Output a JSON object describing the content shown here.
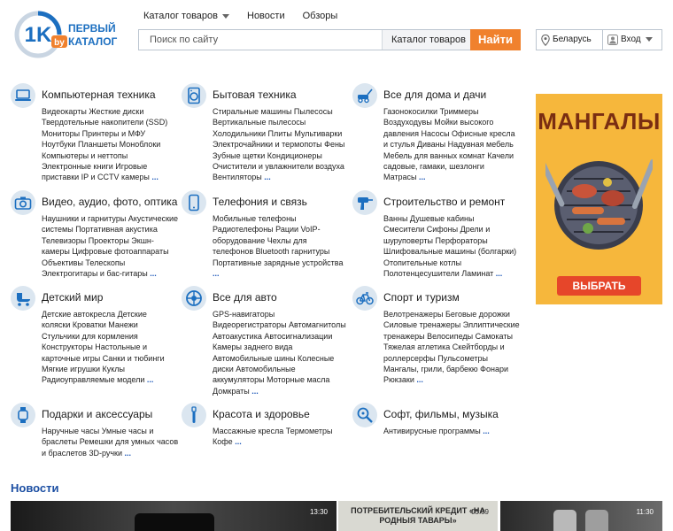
{
  "logo": {
    "mark": "1K",
    "sub": "by",
    "line1": "ПЕРВЫЙ",
    "line2": "КАТАЛОГ"
  },
  "nav": {
    "catalog": "Каталог товаров",
    "news": "Новости",
    "reviews": "Обзоры"
  },
  "search": {
    "placeholder": "Поиск по сайту",
    "category": "Каталог товаров",
    "button": "Найти"
  },
  "region": "Беларусь",
  "login": "Вход",
  "more": "...",
  "categories": [
    {
      "title": "Компьютерная техника",
      "icon": "laptop-icon",
      "lines": [
        "Видеокарты  Жесткие диски",
        "Твердотельные накопители (SSD)",
        "Мониторы  Принтеры и МФУ",
        "Ноутбуки  Планшеты  Моноблоки",
        "Компьютеры и неттопы",
        "Электронные книги  Игровые",
        "приставки  IP и CCTV камеры"
      ]
    },
    {
      "title": "Бытовая техника",
      "icon": "washing-machine-icon",
      "lines": [
        "Стиральные машины  Пылесосы",
        "Вертикальные пылесосы",
        "Холодильники  Плиты  Мультиварки",
        "Электрочайники и термопоты  Фены",
        "Зубные щетки  Кондиционеры",
        "Очистители и увлажнители воздуха",
        "Вентиляторы"
      ]
    },
    {
      "title": "Все для дома и дачи",
      "icon": "lawn-mower-icon",
      "lines": [
        "Газонокосилки  Триммеры",
        "Воздуходувы  Мойки высокого",
        "давления  Насосы  Офисные кресла",
        "и стулья  Диваны  Надувная мебель",
        "Мебель для ванных комнат  Качели",
        "садовые, гамаки, шезлонги",
        "Матрасы"
      ]
    },
    {
      "title": "Видео, аудио, фото, оптика",
      "icon": "camera-icon",
      "lines": [
        "Наушники и гарнитуры  Акустические",
        "системы  Портативная акустика",
        "Телевизоры  Проекторы  Экшн-",
        "камеры  Цифровые фотоаппараты",
        "Объективы  Телескопы",
        "Электрогитары и бас-гитары"
      ]
    },
    {
      "title": "Телефония и связь",
      "icon": "smartphone-icon",
      "lines": [
        "Мобильные телефоны",
        "Радиотелефоны  Рации  VoIP-",
        "оборудование  Чехлы для",
        "телефонов  Bluetooth гарнитуры",
        "Портативные зарядные устройства"
      ]
    },
    {
      "title": "Строительство и ремонт",
      "icon": "drill-icon",
      "lines": [
        "Ванны  Душевые кабины",
        "Смесители  Сифоны  Дрели и",
        "шуруповерты  Перфораторы",
        "Шлифовальные машины (болгарки)",
        "Отопительные котлы",
        "Полотенцесушители  Ламинат"
      ]
    },
    {
      "title": "Детский мир",
      "icon": "stroller-icon",
      "lines": [
        "Детские автокресла  Детские",
        "коляски  Кроватки  Манежи",
        "Стульчики для кормления",
        "Конструкторы  Настольные и",
        "карточные игры  Санки и тюбинги",
        "Мягкие игрушки  Куклы",
        "Радиоуправляемые модели"
      ]
    },
    {
      "title": "Все для авто",
      "icon": "wheel-icon",
      "lines": [
        "GPS-навигаторы",
        "Видеорегистраторы  Автомагнитолы",
        "Автоакустика  Автосигнализации",
        "Камеры заднего вида",
        "Автомобильные шины  Колесные",
        "диски  Автомобильные",
        "аккумуляторы  Моторные масла",
        "Домкраты"
      ]
    },
    {
      "title": "Спорт и туризм",
      "icon": "bicycle-icon",
      "lines": [
        "Велотренажеры  Беговые дорожки",
        "Силовые тренажеры  Эллиптические",
        "тренажеры  Велосипеды  Самокаты",
        "Тяжелая атлетика  Скейтборды и",
        "роллерсерфы  Пульсометры",
        "Мангалы, грили, барбекю  Фонари",
        "Рюкзаки"
      ]
    },
    {
      "title": "Подарки и аксессуары",
      "icon": "watch-icon",
      "lines": [
        "Наручные часы  Умные часы и",
        "браслеты  Ремешки для умных часов",
        "и браслетов  3D-ручки"
      ]
    },
    {
      "title": "Красота и здоровье",
      "icon": "toothbrush-icon",
      "lines": [
        "Массажные кресла  Термометры",
        "Кофе"
      ]
    },
    {
      "title": "Софт, фильмы, музыка",
      "icon": "search-disc-icon",
      "lines": [
        "Антивирусные программы"
      ]
    }
  ],
  "banner": {
    "title": "МАНГАЛЫ",
    "button": "ВЫБРАТЬ"
  },
  "news": {
    "heading": "Новости",
    "items": [
      {
        "time": "13:30",
        "caption": ""
      },
      {
        "time": "05:09",
        "caption": "ПОТРЕБИТЕЛЬСКИЙ КРЕДИТ «НА РОДНЫЯ ТАВАРЫ»"
      },
      {
        "time": "11:30",
        "caption": ""
      }
    ]
  },
  "colors": {
    "accent": "#f0812d",
    "link": "#1a56b8",
    "icon_bg": "#dbe6f0",
    "logo_blue": "#1c6fc0"
  }
}
